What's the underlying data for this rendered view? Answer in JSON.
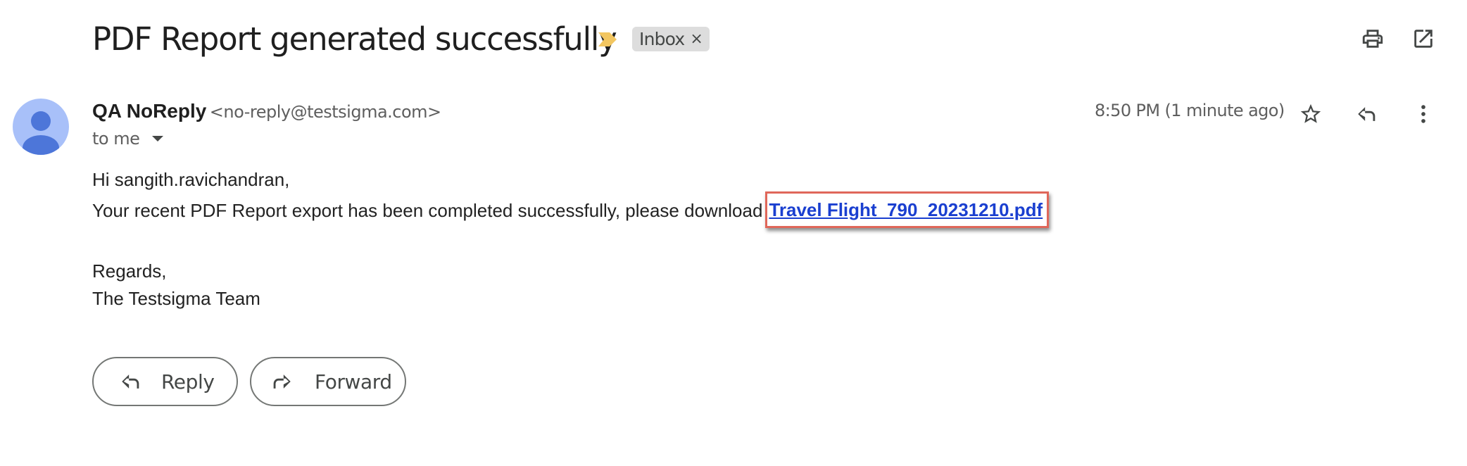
{
  "header": {
    "subject": "PDF Report generated successfully",
    "label_chip": "Inbox",
    "label_remove": "×",
    "important_color": "#f2c661",
    "actions": [
      {
        "name": "print-icon",
        "label": "Print all"
      },
      {
        "name": "open-in-new-window-icon",
        "label": "In new window"
      }
    ]
  },
  "message": {
    "sender_name": "QA NoReply",
    "sender_email": "<no-reply@testsigma.com>",
    "recipient": "to me",
    "timestamp": "8:50 PM (1 minute ago)",
    "actions": [
      {
        "name": "star-icon"
      },
      {
        "name": "reply-icon"
      },
      {
        "name": "more-vert-icon"
      }
    ],
    "avatar_colors": {
      "bg": "#a8c0f9",
      "fg": "#4d76d9"
    },
    "body": {
      "greeting": "Hi sangith.ravichandran,",
      "line1_prefix": "Your recent PDF Report export has been completed successfully, please download",
      "link_text": "Travel Flight_790_20231210.pdf",
      "closing": "Regards,",
      "signature": "The Testsigma Team"
    },
    "highlight_color": "#e0675a",
    "link_color": "#1a3fd0"
  },
  "footer": {
    "reply_label": "Reply",
    "forward_label": "Forward"
  }
}
